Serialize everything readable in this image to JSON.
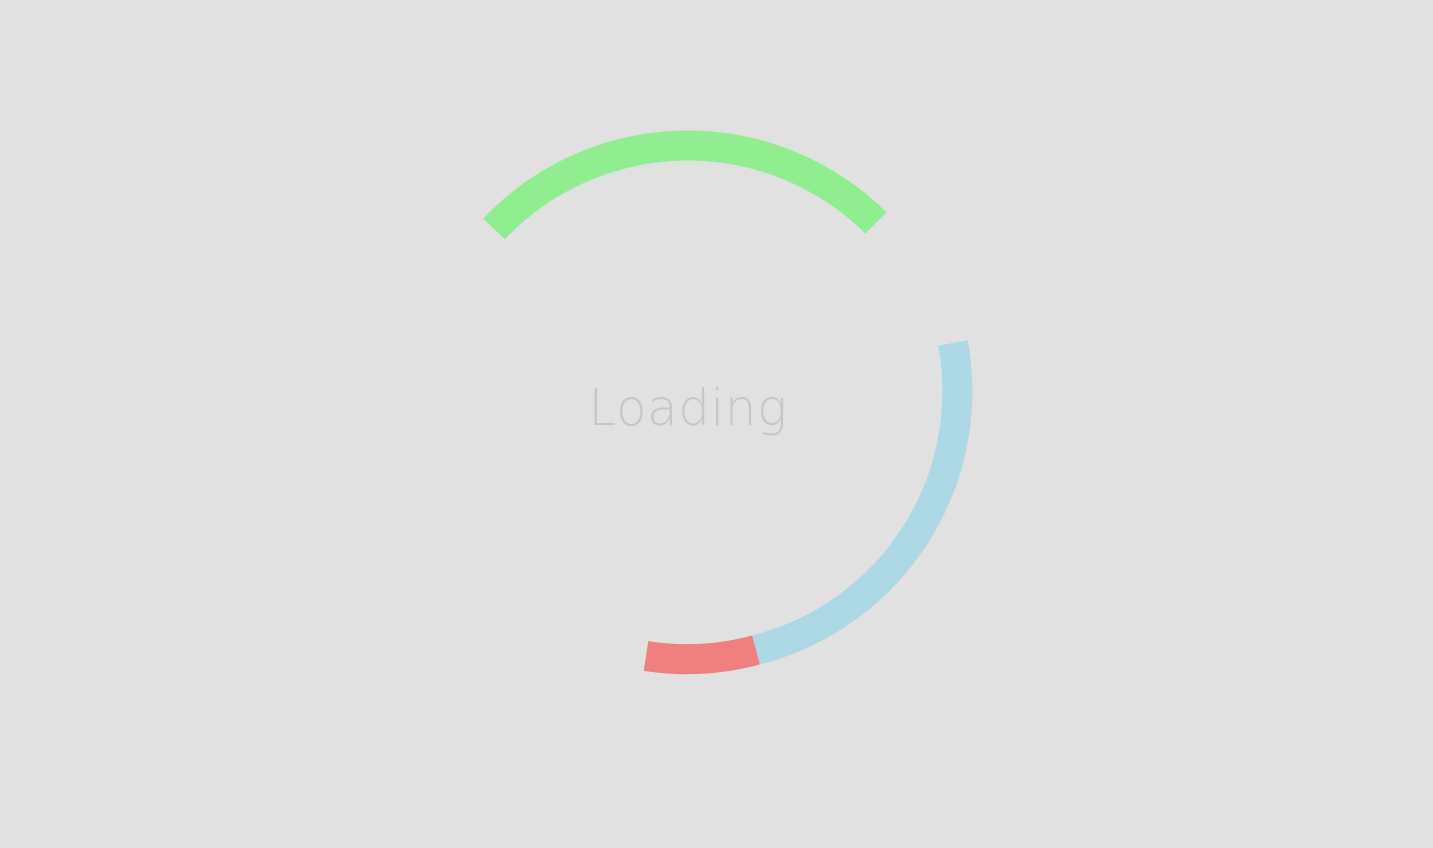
{
  "loader": {
    "label": "Loading",
    "label_color": "#c7c7c7",
    "background_color": "#e1e1e1",
    "arcs": [
      {
        "id": "green",
        "color": "#90ee90"
      },
      {
        "id": "blue",
        "color": "#add8e6"
      },
      {
        "id": "red",
        "color": "#f08080"
      }
    ]
  }
}
